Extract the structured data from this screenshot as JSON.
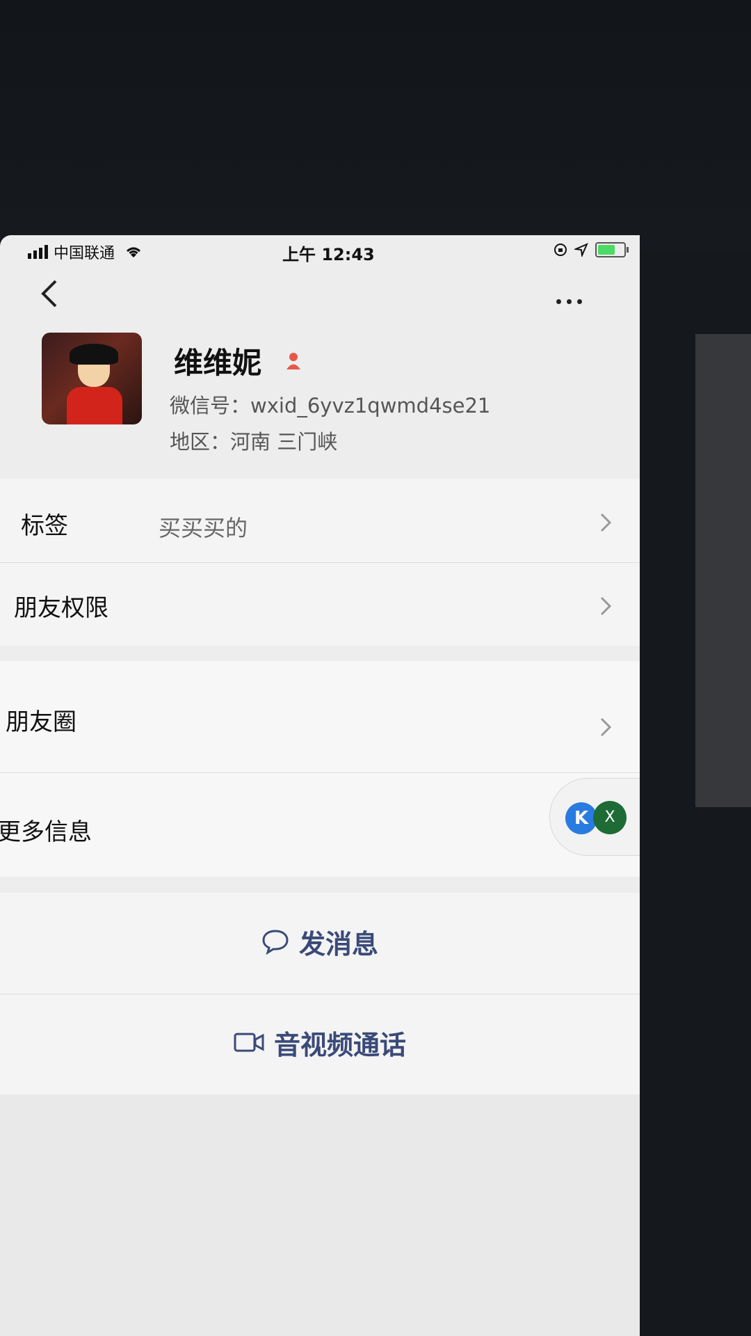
{
  "status_bar": {
    "carrier": "中国联通",
    "time": "上午 12:43"
  },
  "profile": {
    "name": "维维妮",
    "wechat_id": "微信号：wxid_6yvz1qwmd4se21",
    "region": "地区：河南 三门峡",
    "gender_icon": "female-icon",
    "gender_color": "#e5594a"
  },
  "menu": {
    "tags_label": "标签",
    "tags_value": "买买买的",
    "permissions_label": "朋友权限",
    "moments_label": "朋友圈",
    "more_info_label": "更多信息"
  },
  "floating": {
    "close_label": "X"
  },
  "actions": {
    "message_label": "发消息",
    "call_label": "音视频通话"
  },
  "colors": {
    "action_text": "#3a4a78",
    "background": "#ededed"
  }
}
